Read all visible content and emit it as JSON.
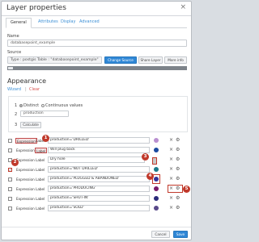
{
  "dialog": {
    "title": "Layer properties",
    "close_glyph": "×"
  },
  "tabs": [
    "General",
    "Attributes",
    "Display",
    "Advanced"
  ],
  "name": {
    "label": "Name",
    "value": "databasepoint_example"
  },
  "source": {
    "label": "Source",
    "value": "Type : postgis  Table : \"databasepoint_example\"",
    "change_button": "Change Source",
    "share_button": "Share Layer",
    "more_button": "More info"
  },
  "appearance": {
    "heading": "Appearance",
    "wizard_link": "Wizard",
    "separator": "|",
    "clear_link": "Clear",
    "rows": [
      {
        "num": "1",
        "options": [
          "Distinct",
          "Continuous values"
        ]
      },
      {
        "num": "2",
        "select": "production"
      },
      {
        "num": "3",
        "button": "Calculate"
      }
    ]
  },
  "rules": [
    {
      "checked": false,
      "expression_label": "Expression",
      "label_label": "Label",
      "value": "production='DRILLED'",
      "color": "#b98fd0",
      "expr_active": true,
      "label_active": false
    },
    {
      "checked": false,
      "expression_label": "Expression",
      "label_label": "Label",
      "value": "Will plug back",
      "color": "#1a4aa0",
      "expr_active": false,
      "label_active": true
    },
    {
      "checked": false,
      "expression_label": "Expression",
      "label_label": "Label",
      "value": "Dry hole",
      "color": "#c8c8c8",
      "expr_active": false,
      "label_active": false
    },
    {
      "checked": true,
      "expression_label": "Expression",
      "label_label": "Label",
      "value": "production='NOT DRILLED'",
      "color": "#1a7a8a",
      "expr_active": false,
      "label_active": false
    },
    {
      "checked": false,
      "expression_label": "Expression",
      "label_label": "Label",
      "value": "production='PLUGGED & ABANDONED'",
      "color": "#333399",
      "expr_active": false,
      "label_active": false
    },
    {
      "checked": false,
      "expression_label": "Expression",
      "label_label": "Label",
      "value": "production='PRODUCING'",
      "color": "#7a1a6a",
      "expr_active": false,
      "label_active": false
    },
    {
      "checked": false,
      "expression_label": "Expression",
      "label_label": "Label",
      "value": "production='SHUT-IN'",
      "color": "#2a2a7a",
      "expr_active": false,
      "label_active": false
    },
    {
      "checked": false,
      "expression_label": "Expression",
      "label_label": "Label",
      "value": "production='SOLD'",
      "color": "#5a4a8a",
      "expr_active": false,
      "label_active": false
    }
  ],
  "callouts": [
    "1",
    "2",
    "3",
    "4",
    "5"
  ],
  "footer": {
    "cancel": "Cancel",
    "save": "Save"
  },
  "icons": {
    "delete": "×",
    "settings": "⚙",
    "check": "✓"
  },
  "colors": {
    "accent": "#2f87d6",
    "callout": "#c0392b"
  }
}
